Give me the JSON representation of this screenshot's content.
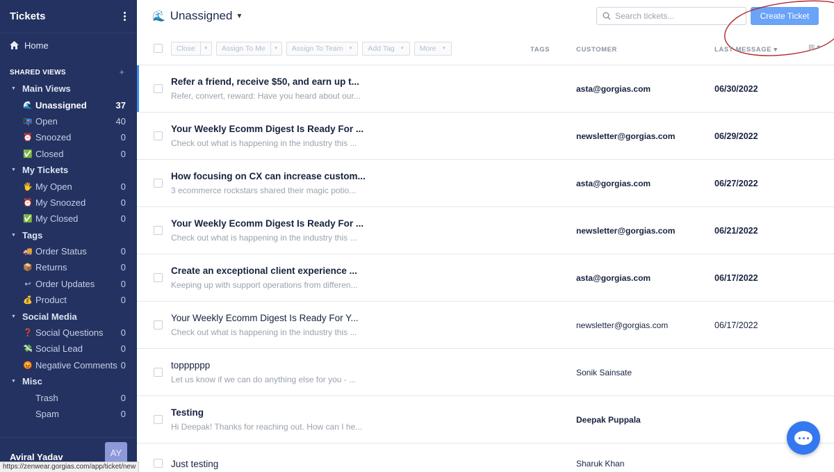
{
  "sidebar": {
    "title": "Tickets",
    "home_label": "Home",
    "shared_views_label": "SHARED VIEWS",
    "sections": [
      {
        "title": "Main Views",
        "items": [
          {
            "emoji": "🌊",
            "label": "Unassigned",
            "count": "37",
            "active": true
          },
          {
            "emoji": "📭",
            "label": "Open",
            "count": "40"
          },
          {
            "emoji": "⏰",
            "label": "Snoozed",
            "count": "0"
          },
          {
            "emoji": "✅",
            "label": "Closed",
            "count": "0"
          }
        ]
      },
      {
        "title": "My Tickets",
        "items": [
          {
            "emoji": "🖐",
            "label": "My Open",
            "count": "0"
          },
          {
            "emoji": "⏰",
            "label": "My Snoozed",
            "count": "0"
          },
          {
            "emoji": "✅",
            "label": "My Closed",
            "count": "0"
          }
        ]
      },
      {
        "title": "Tags",
        "items": [
          {
            "emoji": "🚚",
            "label": "Order Status",
            "count": "0"
          },
          {
            "emoji": "📦",
            "label": "Returns",
            "count": "0"
          },
          {
            "emoji": "↩",
            "label": "Order Updates",
            "count": "0"
          },
          {
            "emoji": "💰",
            "label": "Product",
            "count": "0"
          }
        ]
      },
      {
        "title": "Social Media",
        "items": [
          {
            "emoji": "❓",
            "label": "Social Questions",
            "count": "0"
          },
          {
            "emoji": "💸",
            "label": "Social Lead",
            "count": "0"
          },
          {
            "emoji": "😡",
            "label": "Negative Comments",
            "count": "0"
          }
        ]
      },
      {
        "title": "Misc",
        "items": [
          {
            "emoji": "",
            "label": "Trash",
            "count": "0"
          },
          {
            "emoji": "",
            "label": "Spam",
            "count": "0"
          }
        ]
      }
    ],
    "user_name": "Aviral Yadav",
    "avatar_initials": "AY",
    "status_url": "https://zenwear.gorgias.com/app/ticket/new"
  },
  "header": {
    "view_emoji": "🌊",
    "view_title": "Unassigned",
    "search_placeholder": "Search tickets...",
    "create_label": "Create Ticket"
  },
  "toolbar": {
    "close": "Close",
    "assign_me": "Assign To Me",
    "assign_team": "Assign To Team",
    "add_tag": "Add Tag",
    "more": "More",
    "col_tags": "TAGS",
    "col_customer": "CUSTOMER",
    "col_last_message": "LAST MESSAGE"
  },
  "tickets": [
    {
      "subject": "Refer a friend, receive $50, and earn up t...",
      "preview": "Refer, convert, reward: Have you heard about our...",
      "customer": "asta@gorgias.com",
      "date": "06/30/2022",
      "unread": true,
      "selected": true
    },
    {
      "subject": "Your Weekly Ecomm Digest Is Ready For ...",
      "preview": "Check out what is happening in the industry this ...",
      "customer": "newsletter@gorgias.com",
      "date": "06/29/2022",
      "unread": true
    },
    {
      "subject": "How focusing on CX can increase custom...",
      "preview": "3 ecommerce rockstars shared their magic potio...",
      "customer": "asta@gorgias.com",
      "date": "06/27/2022",
      "unread": true
    },
    {
      "subject": "Your Weekly Ecomm Digest Is Ready For ...",
      "preview": "Check out what is happening in the industry this ...",
      "customer": "newsletter@gorgias.com",
      "date": "06/21/2022",
      "unread": true
    },
    {
      "subject": "Create an exceptional client experience ...",
      "preview": "Keeping up with support operations from differen...",
      "customer": "asta@gorgias.com",
      "date": "06/17/2022",
      "unread": true
    },
    {
      "subject": "Your Weekly Ecomm Digest Is Ready For Y...",
      "preview": "Check out what is happening in the industry this ...",
      "customer": "newsletter@gorgias.com",
      "date": "06/17/2022",
      "unread": false
    },
    {
      "subject": "topppppp",
      "preview": "Let us know if we can do anything else for you - ...",
      "customer": "Sonik Sainsate",
      "date": "",
      "unread": false
    },
    {
      "subject": "Testing",
      "preview": "Hi Deepak! Thanks for reaching out. How can I he...",
      "customer": "Deepak Puppala",
      "date": "",
      "unread": true
    },
    {
      "subject": "Just testing",
      "preview": "",
      "customer": "Sharuk Khan",
      "date": "",
      "unread": false
    }
  ],
  "colors": {
    "sidebar_bg": "#233260",
    "accent": "#3f8bf0",
    "create_button": "#6aa3f7",
    "annotation": "#b3252b"
  }
}
